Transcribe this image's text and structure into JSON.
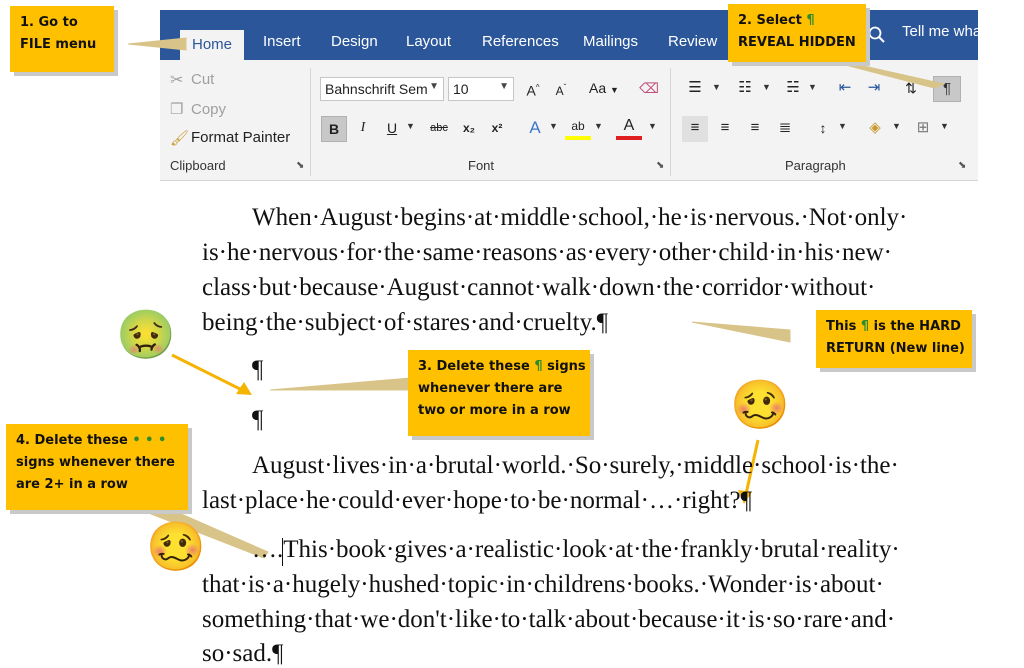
{
  "ribbon": {
    "tabs": [
      "Home",
      "Insert",
      "Design",
      "Layout",
      "References",
      "Mailings",
      "Review"
    ],
    "tell_me": "Tell me wha",
    "clipboard": {
      "label": "Clipboard",
      "cut": "Cut",
      "copy": "Copy",
      "format_painter": "Format Painter"
    },
    "font": {
      "label": "Font",
      "font_name": "Bahnschrift Sem",
      "font_size": "10",
      "grow": "A",
      "shrink": "A",
      "change_case": "Aa",
      "bold": "B",
      "italic": "I",
      "underline": "U",
      "strike": "abc",
      "subscript": "x₂",
      "superscript": "x²",
      "text_effects": "A",
      "highlight": "ab",
      "font_color": "A"
    },
    "paragraph": {
      "label": "Paragraph",
      "show_hide": "¶"
    }
  },
  "callouts": {
    "step1": [
      "1. Go to",
      "FILE menu"
    ],
    "step2": [
      "2. Select ¶",
      "REVEAL HIDDEN"
    ],
    "hard_return": [
      "This ¶ is the HARD",
      "RETURN (New line)"
    ],
    "step3": [
      "3. Delete these ¶ signs",
      "whenever there are",
      "two or more in a row"
    ],
    "step4": [
      "4. Delete these • • •",
      "signs whenever there",
      "are 2+ in a row"
    ]
  },
  "document": {
    "lines": [
      "When·August·begins·at·middle·school,·he·is·nervous.·Not·only·",
      "is·he·nervous·for·the·same·reasons·as·every·other·child·in·his·new·",
      "class·but·because·August·cannot·walk·down·the·corridor·without·",
      "being·the·subject·of·stares·and·cruelty.¶",
      "¶",
      "¶",
      "August·lives·in·a·brutal·world.·So·surely,·middle·school·is·the·",
      "last·place·he·could·ever·hope·to·be·normal·…·right?¶",
      "….This·book·gives·a·realistic·look·at·the·frankly·brutal·reality·",
      "that·is·a·hugely·hushed·topic·in·childrens·books.·Wonder·is·about·",
      "something·that·we·don't·like·to·talk·about·because·it·is·so·rare·and·",
      "so·sad.¶"
    ]
  },
  "colors": {
    "ribbon_blue": "#2b579a",
    "callout_yellow": "#ffc000",
    "arrow_tan": "#d8c488"
  },
  "icons": [
    "scissors-icon",
    "copy-icon",
    "format-painter-icon",
    "clear-formatting-icon",
    "bullets-icon",
    "numbering-icon",
    "multilevel-list-icon",
    "decrease-indent-icon",
    "increase-indent-icon",
    "sort-icon",
    "pilcrow-icon",
    "align-left-icon",
    "center-icon",
    "align-right-icon",
    "justify-icon",
    "line-spacing-icon",
    "shading-icon",
    "borders-icon",
    "search-icon",
    "nauseated-emoji",
    "woozy-emoji"
  ]
}
